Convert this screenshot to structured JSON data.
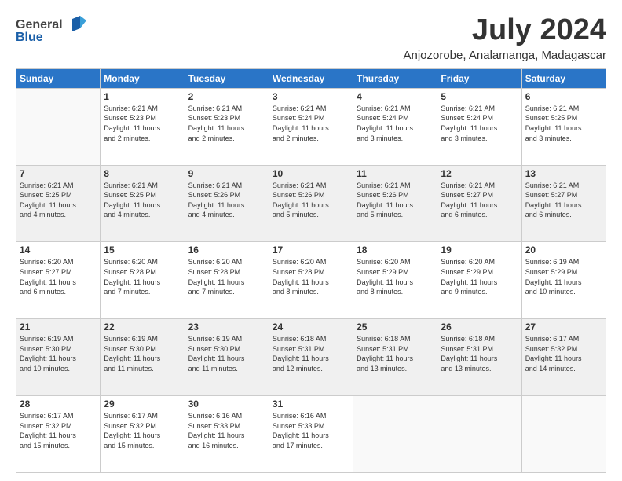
{
  "header": {
    "logo": {
      "general": "General",
      "blue": "Blue"
    },
    "title": "July 2024",
    "location": "Anjozorobe, Analamanga, Madagascar"
  },
  "columns": [
    "Sunday",
    "Monday",
    "Tuesday",
    "Wednesday",
    "Thursday",
    "Friday",
    "Saturday"
  ],
  "weeks": [
    [
      {
        "day": "",
        "info": ""
      },
      {
        "day": "1",
        "info": "Sunrise: 6:21 AM\nSunset: 5:23 PM\nDaylight: 11 hours\nand 2 minutes."
      },
      {
        "day": "2",
        "info": "Sunrise: 6:21 AM\nSunset: 5:23 PM\nDaylight: 11 hours\nand 2 minutes."
      },
      {
        "day": "3",
        "info": "Sunrise: 6:21 AM\nSunset: 5:24 PM\nDaylight: 11 hours\nand 2 minutes."
      },
      {
        "day": "4",
        "info": "Sunrise: 6:21 AM\nSunset: 5:24 PM\nDaylight: 11 hours\nand 3 minutes."
      },
      {
        "day": "5",
        "info": "Sunrise: 6:21 AM\nSunset: 5:24 PM\nDaylight: 11 hours\nand 3 minutes."
      },
      {
        "day": "6",
        "info": "Sunrise: 6:21 AM\nSunset: 5:25 PM\nDaylight: 11 hours\nand 3 minutes."
      }
    ],
    [
      {
        "day": "7",
        "info": "Sunrise: 6:21 AM\nSunset: 5:25 PM\nDaylight: 11 hours\nand 4 minutes."
      },
      {
        "day": "8",
        "info": "Sunrise: 6:21 AM\nSunset: 5:25 PM\nDaylight: 11 hours\nand 4 minutes."
      },
      {
        "day": "9",
        "info": "Sunrise: 6:21 AM\nSunset: 5:26 PM\nDaylight: 11 hours\nand 4 minutes."
      },
      {
        "day": "10",
        "info": "Sunrise: 6:21 AM\nSunset: 5:26 PM\nDaylight: 11 hours\nand 5 minutes."
      },
      {
        "day": "11",
        "info": "Sunrise: 6:21 AM\nSunset: 5:26 PM\nDaylight: 11 hours\nand 5 minutes."
      },
      {
        "day": "12",
        "info": "Sunrise: 6:21 AM\nSunset: 5:27 PM\nDaylight: 11 hours\nand 6 minutes."
      },
      {
        "day": "13",
        "info": "Sunrise: 6:21 AM\nSunset: 5:27 PM\nDaylight: 11 hours\nand 6 minutes."
      }
    ],
    [
      {
        "day": "14",
        "info": "Sunrise: 6:20 AM\nSunset: 5:27 PM\nDaylight: 11 hours\nand 6 minutes."
      },
      {
        "day": "15",
        "info": "Sunrise: 6:20 AM\nSunset: 5:28 PM\nDaylight: 11 hours\nand 7 minutes."
      },
      {
        "day": "16",
        "info": "Sunrise: 6:20 AM\nSunset: 5:28 PM\nDaylight: 11 hours\nand 7 minutes."
      },
      {
        "day": "17",
        "info": "Sunrise: 6:20 AM\nSunset: 5:28 PM\nDaylight: 11 hours\nand 8 minutes."
      },
      {
        "day": "18",
        "info": "Sunrise: 6:20 AM\nSunset: 5:29 PM\nDaylight: 11 hours\nand 8 minutes."
      },
      {
        "day": "19",
        "info": "Sunrise: 6:20 AM\nSunset: 5:29 PM\nDaylight: 11 hours\nand 9 minutes."
      },
      {
        "day": "20",
        "info": "Sunrise: 6:19 AM\nSunset: 5:29 PM\nDaylight: 11 hours\nand 10 minutes."
      }
    ],
    [
      {
        "day": "21",
        "info": "Sunrise: 6:19 AM\nSunset: 5:30 PM\nDaylight: 11 hours\nand 10 minutes."
      },
      {
        "day": "22",
        "info": "Sunrise: 6:19 AM\nSunset: 5:30 PM\nDaylight: 11 hours\nand 11 minutes."
      },
      {
        "day": "23",
        "info": "Sunrise: 6:19 AM\nSunset: 5:30 PM\nDaylight: 11 hours\nand 11 minutes."
      },
      {
        "day": "24",
        "info": "Sunrise: 6:18 AM\nSunset: 5:31 PM\nDaylight: 11 hours\nand 12 minutes."
      },
      {
        "day": "25",
        "info": "Sunrise: 6:18 AM\nSunset: 5:31 PM\nDaylight: 11 hours\nand 13 minutes."
      },
      {
        "day": "26",
        "info": "Sunrise: 6:18 AM\nSunset: 5:31 PM\nDaylight: 11 hours\nand 13 minutes."
      },
      {
        "day": "27",
        "info": "Sunrise: 6:17 AM\nSunset: 5:32 PM\nDaylight: 11 hours\nand 14 minutes."
      }
    ],
    [
      {
        "day": "28",
        "info": "Sunrise: 6:17 AM\nSunset: 5:32 PM\nDaylight: 11 hours\nand 15 minutes."
      },
      {
        "day": "29",
        "info": "Sunrise: 6:17 AM\nSunset: 5:32 PM\nDaylight: 11 hours\nand 15 minutes."
      },
      {
        "day": "30",
        "info": "Sunrise: 6:16 AM\nSunset: 5:33 PM\nDaylight: 11 hours\nand 16 minutes."
      },
      {
        "day": "31",
        "info": "Sunrise: 6:16 AM\nSunset: 5:33 PM\nDaylight: 11 hours\nand 17 minutes."
      },
      {
        "day": "",
        "info": ""
      },
      {
        "day": "",
        "info": ""
      },
      {
        "day": "",
        "info": ""
      }
    ]
  ]
}
